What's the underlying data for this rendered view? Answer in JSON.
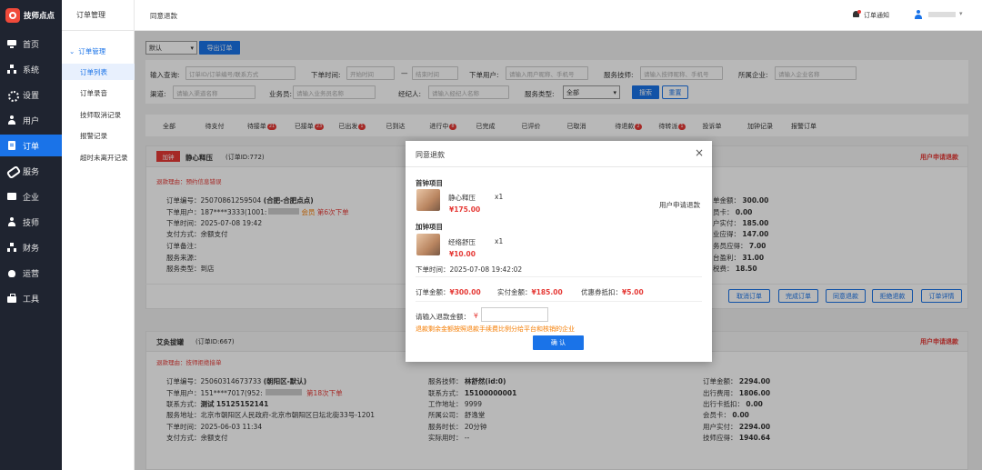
{
  "app": {
    "name": "技师点点"
  },
  "nav": {
    "items": [
      {
        "label": "首页",
        "icon": "desktop-icon"
      },
      {
        "label": "系统",
        "icon": "tree-icon"
      },
      {
        "label": "设置",
        "icon": "gear-icon"
      },
      {
        "label": "用户",
        "icon": "user-icon"
      },
      {
        "label": "订单",
        "icon": "document-icon"
      },
      {
        "label": "服务",
        "icon": "link-icon"
      },
      {
        "label": "企业",
        "icon": "box-icon"
      },
      {
        "label": "技师",
        "icon": "user-icon"
      },
      {
        "label": "财务",
        "icon": "tree-icon"
      },
      {
        "label": "运营",
        "icon": "fire-icon"
      },
      {
        "label": "工具",
        "icon": "briefcase-icon"
      }
    ]
  },
  "submenu": {
    "header": "订单管理",
    "group": "订单管理",
    "items": [
      "订单列表",
      "订单录音",
      "技师取消记录",
      "报警记录",
      "超时未离开记录"
    ]
  },
  "topbar": {
    "breadcrumb": "同意退款",
    "notification": "订单通知",
    "username": ""
  },
  "toolbar": {
    "select_value": "默认",
    "export_label": "导出订单"
  },
  "filters": {
    "input_query_label": "输入查询:",
    "input_query_placeholder": "订单ID/订单编号/联系方式",
    "time_label": "下单时间:",
    "start_placeholder": "开始时间",
    "dash": "—",
    "end_placeholder": "结束时间",
    "user_label": "下单用户:",
    "user_placeholder": "请输入用户昵称、手机号",
    "tech_label": "服务技师:",
    "tech_placeholder": "请输入技师昵称、手机号",
    "company_label": "所属企业:",
    "company_placeholder": "请输入企业名称",
    "channel_label": "渠道:",
    "channel_placeholder": "请输入渠道名称",
    "sales_label": "业务员:",
    "sales_placeholder": "请输入业务员名称",
    "agent_label": "经纪人:",
    "agent_placeholder": "请输入经纪人名称",
    "type_label": "服务类型:",
    "type_value": "全部",
    "search_label": "搜索",
    "reset_label": "重置"
  },
  "tabs": [
    {
      "label": "全部",
      "badge": ""
    },
    {
      "label": "待支付",
      "badge": ""
    },
    {
      "label": "待接单",
      "badge": "21"
    },
    {
      "label": "已接单",
      "badge": "23"
    },
    {
      "label": "已出发",
      "badge": "1"
    },
    {
      "label": "已到达",
      "badge": ""
    },
    {
      "label": "进行中",
      "badge": "8"
    },
    {
      "label": "已完成",
      "badge": ""
    },
    {
      "label": "已评价",
      "badge": ""
    },
    {
      "label": "已取消",
      "badge": ""
    },
    {
      "label": "待退款",
      "badge": "2"
    },
    {
      "label": "待转派",
      "badge": "1"
    },
    {
      "label": "投诉单",
      "badge": ""
    },
    {
      "label": "加钟记录",
      "badge": ""
    },
    {
      "label": "报警订单",
      "badge": ""
    }
  ],
  "order1": {
    "tag": "加钟",
    "service": "静心释压",
    "order_id": "(订单ID:772)",
    "status": "用户申请退款",
    "reason": "退款理由：预约信息错误",
    "no_label": "订单编号：",
    "no": "25070861259504",
    "region": "(合肥-合肥点点)",
    "user_label": "下单用户：",
    "user": "187****3333(1001:",
    "user_tag": "会员",
    "user_count": "第6次下单",
    "time_label": "下单时间：",
    "time": "2025-07-08 19:42",
    "pay_label": "支付方式：",
    "pay": "余额支付",
    "remark_label": "订单备注：",
    "source_label": "服务来源：",
    "type_label": "服务类型：",
    "type": "到店",
    "right": [
      {
        "label": "单金额：",
        "value": "300.00"
      },
      {
        "label": "员卡：",
        "value": "0.00"
      },
      {
        "label": "户实付：",
        "value": "185.00"
      },
      {
        "label": "业应得：",
        "value": "147.00"
      },
      {
        "label": "务员应得：",
        "value": "7.00"
      },
      {
        "label": "台盈利：",
        "value": "31.00"
      },
      {
        "label": "税费：",
        "value": "18.50"
      }
    ],
    "buttons": [
      "取消订单",
      "完成订单",
      "同意退款",
      "拒绝退款",
      "订单详情"
    ]
  },
  "order2": {
    "service": "艾灸拔罐",
    "order_id": "(订单ID:667)",
    "status": "用户申请退款",
    "reason": "退款理由：技师拒绝接单",
    "no_label": "订单编号：",
    "no": "25060314673733",
    "region": "(朝阳区-默认)",
    "user_label": "下单用户：",
    "user": "151****7017(952:",
    "user_count": "第18次下单",
    "contact_label": "联系方式：",
    "contact_name": "测试",
    "contact_phone": "15125152141",
    "addr_label": "服务地址：",
    "addr": "北京市朝阳区人民政府-北京市朝阳区日坛北街33号-1201",
    "time_label": "下单时间：",
    "time": "2025-06-03 11:34",
    "pay_label": "支付方式：",
    "pay": "余额支付",
    "mid": [
      {
        "label": "服务技师：",
        "value": "林舒然(id:0)"
      },
      {
        "label": "联系方式：",
        "value": "15100000001"
      },
      {
        "label": "工作地址：",
        "value": "9999"
      },
      {
        "label": "所属公司：",
        "value": "舒逸堂"
      },
      {
        "label": "服务时长：",
        "value": "20分钟"
      },
      {
        "label": "实际用时：",
        "value": "--"
      }
    ],
    "right": [
      {
        "label": "订单金额：",
        "value": "2294.00"
      },
      {
        "label": "出行费用：",
        "value": "1806.00"
      },
      {
        "label": "出行卡抵扣：",
        "value": "0.00"
      },
      {
        "label": "会员卡：",
        "value": "0.00"
      },
      {
        "label": "用户实付：",
        "value": "2294.00"
      },
      {
        "label": "技师应得：",
        "value": "1940.64"
      }
    ]
  },
  "modal": {
    "title": "同意退款",
    "close": "×",
    "first_label": "首钟项目",
    "first_name": "静心释压",
    "first_qty": "x1",
    "first_price": "¥175.00",
    "refund_note": "用户申请退款",
    "extra_label": "加钟项目",
    "extra_name": "经络舒压",
    "extra_qty": "x1",
    "extra_price": "¥10.00",
    "order_time": "下单时间：2025-07-08 19:42:02",
    "total_label": "订单金额：",
    "total": "¥300.00",
    "paid_label": "实付金额：",
    "paid": "¥185.00",
    "coupon_label": "优惠券抵扣：",
    "coupon": "¥5.00",
    "input_label": "请输入退款金额：",
    "currency": "¥",
    "input_value": "",
    "hint": "退款剩余金额按照退款手续费比例分给平台和核销的企业",
    "confirm": "确 认"
  }
}
